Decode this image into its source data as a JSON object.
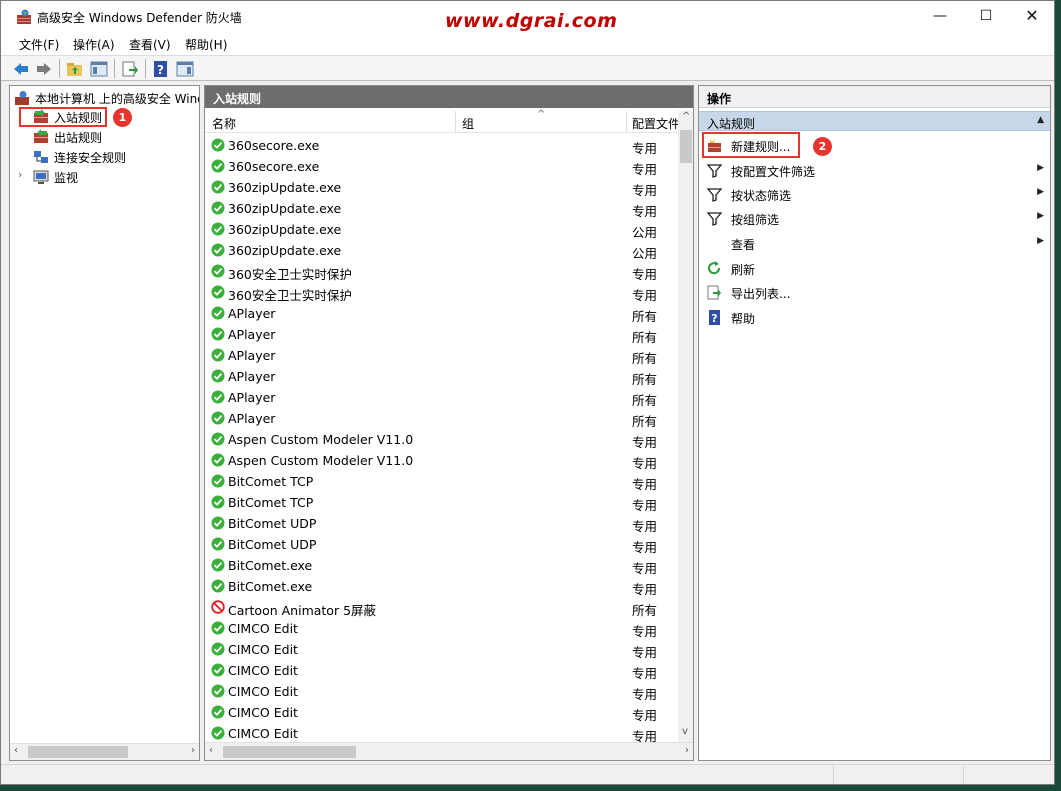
{
  "window": {
    "title": "高级安全 Windows Defender 防火墙",
    "watermark": "www.dgrai.com",
    "minimize_glyph": "—",
    "maximize_glyph": "☐",
    "close_glyph": "✕"
  },
  "menu": [
    "文件(F)",
    "操作(A)",
    "查看(V)",
    "帮助(H)"
  ],
  "toolbar": [
    "back-arrow-icon",
    "forward-arrow-icon",
    "up-folder-icon",
    "show-hide-tree-icon",
    "export-list-icon",
    "help-icon",
    "action-pane-icon"
  ],
  "tree": {
    "root": "本地计算机 上的高级安全 Windows Defender 防火墙",
    "items": [
      {
        "label": "入站规则",
        "icon": "inbound-rules-icon",
        "selected": true
      },
      {
        "label": "出站规则",
        "icon": "outbound-rules-icon"
      },
      {
        "label": "连接安全规则",
        "icon": "connection-security-icon"
      },
      {
        "label": "监视",
        "icon": "monitor-icon",
        "expandable": true
      }
    ],
    "badge": "1"
  },
  "list": {
    "header": "入站规则",
    "columns": [
      "名称",
      "组",
      "配置文件"
    ],
    "rows": [
      {
        "name": "360secore.exe",
        "profile": "专用",
        "status": "allow"
      },
      {
        "name": "360secore.exe",
        "profile": "专用",
        "status": "allow"
      },
      {
        "name": "360zipUpdate.exe",
        "profile": "专用",
        "status": "allow"
      },
      {
        "name": "360zipUpdate.exe",
        "profile": "专用",
        "status": "allow"
      },
      {
        "name": "360zipUpdate.exe",
        "profile": "公用",
        "status": "allow"
      },
      {
        "name": "360zipUpdate.exe",
        "profile": "公用",
        "status": "allow"
      },
      {
        "name": "360安全卫士实时保护",
        "profile": "专用",
        "status": "allow"
      },
      {
        "name": "360安全卫士实时保护",
        "profile": "专用",
        "status": "allow"
      },
      {
        "name": "APlayer",
        "profile": "所有",
        "status": "allow"
      },
      {
        "name": "APlayer",
        "profile": "所有",
        "status": "allow"
      },
      {
        "name": "APlayer",
        "profile": "所有",
        "status": "allow"
      },
      {
        "name": "APlayer",
        "profile": "所有",
        "status": "allow"
      },
      {
        "name": "APlayer",
        "profile": "所有",
        "status": "allow"
      },
      {
        "name": "APlayer",
        "profile": "所有",
        "status": "allow"
      },
      {
        "name": "Aspen Custom Modeler V11.0",
        "profile": "专用",
        "status": "allow"
      },
      {
        "name": "Aspen Custom Modeler V11.0",
        "profile": "专用",
        "status": "allow"
      },
      {
        "name": "BitComet TCP",
        "profile": "专用",
        "status": "allow"
      },
      {
        "name": "BitComet TCP",
        "profile": "专用",
        "status": "allow"
      },
      {
        "name": "BitComet UDP",
        "profile": "专用",
        "status": "allow"
      },
      {
        "name": "BitComet UDP",
        "profile": "专用",
        "status": "allow"
      },
      {
        "name": "BitComet.exe",
        "profile": "专用",
        "status": "allow"
      },
      {
        "name": "BitComet.exe",
        "profile": "专用",
        "status": "allow"
      },
      {
        "name": "Cartoon Animator 5屏蔽",
        "profile": "所有",
        "status": "block"
      },
      {
        "name": "CIMCO Edit",
        "profile": "专用",
        "status": "allow"
      },
      {
        "name": "CIMCO Edit",
        "profile": "专用",
        "status": "allow"
      },
      {
        "name": "CIMCO Edit",
        "profile": "专用",
        "status": "allow"
      },
      {
        "name": "CIMCO Edit",
        "profile": "专用",
        "status": "allow"
      },
      {
        "name": "CIMCO Edit",
        "profile": "专用",
        "status": "allow"
      },
      {
        "name": "CIMCO Edit",
        "profile": "专用",
        "status": "allow"
      }
    ]
  },
  "actions": {
    "header": "操作",
    "section": "入站规则",
    "items": [
      {
        "label": "新建规则...",
        "icon": "new-rule-icon",
        "submenu": false
      },
      {
        "label": "按配置文件筛选",
        "icon": "filter-icon",
        "submenu": true
      },
      {
        "label": "按状态筛选",
        "icon": "filter-icon",
        "submenu": true
      },
      {
        "label": "按组筛选",
        "icon": "filter-icon",
        "submenu": true
      },
      {
        "label": "查看",
        "icon": "",
        "submenu": true
      },
      {
        "label": "刷新",
        "icon": "refresh-icon",
        "submenu": false
      },
      {
        "label": "导出列表...",
        "icon": "export-icon",
        "submenu": false
      },
      {
        "label": "帮助",
        "icon": "help-icon",
        "submenu": false
      }
    ],
    "badge": "2"
  },
  "colors": {
    "highlight_red": "#e8342f",
    "watermark_red": "#c00000",
    "allow_green": "#3cae3c",
    "block_red": "#e02020",
    "section_blue": "#c7d7e9"
  }
}
